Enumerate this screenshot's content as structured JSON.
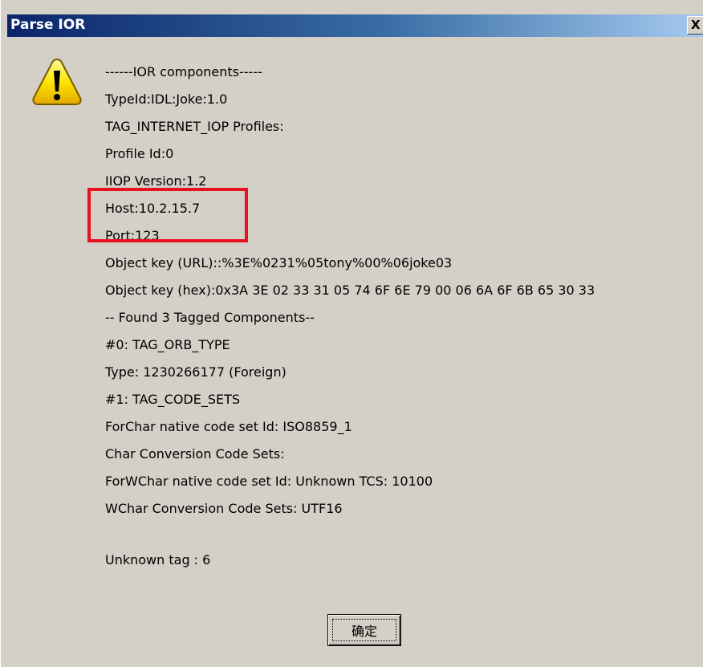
{
  "dialog": {
    "title": "Parse IOR",
    "close_label": "X",
    "ok_label": "确定"
  },
  "message": {
    "lines": [
      "------IOR components-----",
      "TypeId:IDL:Joke:1.0",
      "TAG_INTERNET_IOP Profiles:",
      "Profile Id:0",
      "IIOP Version:1.2",
      "Host:10.2.15.7",
      "Port:123",
      "Object key (URL)::%3E%0231%05tony%00%06joke03",
      "Object key (hex):0x3A 3E 02 33 31 05 74 6F 6E 79 00 06 6A 6F 6B 65 30 33",
      "-- Found 3 Tagged Components--",
      "#0: TAG_ORB_TYPE",
      "Type: 1230266177 (Foreign)",
      "#1: TAG_CODE_SETS",
      "ForChar native code set Id: ISO8859_1",
      "Char Conversion Code Sets:",
      "ForWChar native code set Id: Unknown TCS: 10100",
      "WChar Conversion Code Sets: UTF16",
      "",
      "Unknown tag : 6"
    ]
  },
  "colors": {
    "title_start": "#0a246a",
    "title_end": "#a6caf0",
    "dialog_bg": "#d4d0c8",
    "highlight": "#e8121e",
    "warning_yellow": "#ffe600"
  },
  "icons": {
    "warning": "warning-icon",
    "close": "close-icon"
  }
}
